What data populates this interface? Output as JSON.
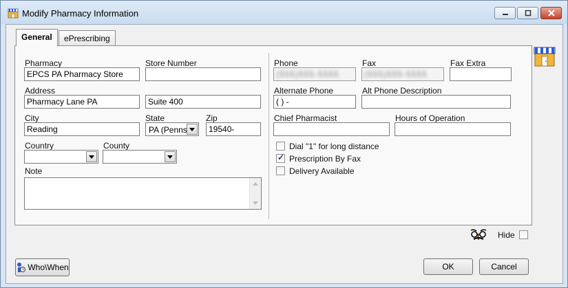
{
  "window": {
    "title": "Modify Pharmacy Information",
    "controls": [
      "minimize",
      "maximize",
      "close"
    ]
  },
  "tabs": [
    {
      "label": "General",
      "active": true
    },
    {
      "label": "ePrescribing",
      "active": false
    }
  ],
  "left": {
    "pharmacy_label": "Pharmacy",
    "pharmacy_value": "EPCS PA Pharmacy Store",
    "store_number_label": "Store Number",
    "store_number_value": "",
    "address_label": "Address",
    "address1_value": "Pharmacy Lane PA",
    "address2_value": "Suite 400",
    "city_label": "City",
    "city_value": "Reading",
    "state_label": "State",
    "state_value": "PA  (Penns",
    "zip_label": "Zip",
    "zip_value": "19540-",
    "country_label": "Country",
    "country_value": "",
    "county_label": "County",
    "county_value": "",
    "note_label": "Note",
    "note_value": ""
  },
  "right": {
    "phone_label": "Phone",
    "phone_value": "(555)555-5555",
    "fax_label": "Fax",
    "fax_value": "(555)555-5555",
    "fax_extra_label": "Fax Extra",
    "fax_extra_value": "",
    "alt_phone_label": "Alternate Phone",
    "alt_phone_value": "(  )    -",
    "alt_phone_desc_label": "Alt Phone Description",
    "alt_phone_desc_value": "",
    "chief_pharmacist_label": "Chief Pharmacist",
    "chief_pharmacist_value": "",
    "hours_label": "Hours of Operation",
    "hours_value": "",
    "checkboxes": [
      {
        "label": "Dial \"1\" for long distance",
        "checked": false
      },
      {
        "label": "Prescription By Fax",
        "checked": true
      },
      {
        "label": "Delivery Available",
        "checked": false
      }
    ]
  },
  "footer": {
    "hide_label": "Hide",
    "hide_checked": false,
    "who_when_label": "Who\\When",
    "ok_label": "OK",
    "cancel_label": "Cancel"
  },
  "colors": {
    "titlebar": "#d3e2f3",
    "store_icon_stripe": "#2d5bd6",
    "store_icon_body": "#f2b53b",
    "close_button": "#c4432c"
  },
  "icons": [
    "pharmacy-store-icon",
    "disguise-glasses-icon",
    "who-when-info-icon",
    "chevron-down-icon"
  ]
}
